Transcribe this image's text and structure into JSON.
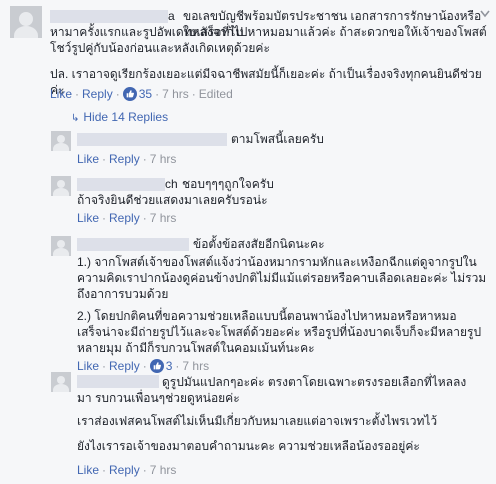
{
  "comment": {
    "name_suffix": "a",
    "text_line1": "ขอเลขบัญชีพร้อมบัตรประชาชน เอกสารการรักษาน้องหรือใบเสร็จที่ไป",
    "text_line2": "หามาครั้งแรกและรูปอัพเดทหลังจากไปหาหมอมาแล้วค่ะ ถ้าสะดวกขอให้เจ้าของโพสต์",
    "text_line3": "โชว์รูปคู่กับน้องก่อนและหลังเกิดเหตุด้วยค่ะ",
    "text_line4": "ปล. เราอาจดูเรียกร้องเยอะแต่มีจฉาชีพสมัยนี้ก็เยอะค่ะ ถ้าเป็นเรื่องจริงทุกคนยินดีช่วยค่ะ",
    "like": "Like",
    "reply": "Reply",
    "likes_count": "35",
    "time": "7 hrs",
    "edited": "Edited"
  },
  "hide_replies": "Hide 14 Replies",
  "replies": [
    {
      "name_suffix": "",
      "text": "ตามโพสนี้เลยครับ",
      "like": "Like",
      "reply": "Reply",
      "time": "7 hrs"
    },
    {
      "name_suffix": "ch",
      "text_line1": "ชอบๆๆๆถูกใจครับ",
      "text_line2": "ถ้าจริงยินดีช่วยแสดงมาเลยครับรอน่ะ",
      "like": "Like",
      "reply": "Reply",
      "time": "7 hrs"
    },
    {
      "name_suffix": "",
      "header_text": "ข้อตั้งข้อสงสัยอีกนิดนะคะ",
      "p1_line1": "1.) จากโพสต์เจ้าของโพสต์แจ้งว่าน้องหมากรามหักและเหงือกฉีกแต่ดูจากรูปใน",
      "p1_line2": "ความคิดเราปากน้องดูค่อนข้างปกติไม่มีแม้แต่รอยหรือคาบเลือดเลยอะค่ะ ไม่รวม",
      "p1_line3": "ถึงอาการบวมด้วย",
      "p2_line1": "2.) โดยปกติคนที่ขอความช่วยเหลือแบบนี้ตอนพาน้องไปหาหมอหรือหาหมอ",
      "p2_line2": "เสร็จน่าจะมีถ่ายรูปไว้และจะโพสต์ด้วยอะค่ะ หรือรูปที่น้องบาดเจ็บก็จะมีหลายรูป",
      "p2_line3": "หลายมุม ถ้ามีก็รบกวนโพสต์ในคอมเม้นท์นะคะ",
      "like": "Like",
      "reply": "Reply",
      "likes_count": "3",
      "time": "7 hrs"
    },
    {
      "name_suffix": "",
      "line1": "ดูรูปมันแปลกๆอะค่ะ ตรงตาโดยเฉพาะตรงรอยเลือกที่ไหลลง",
      "line2": "มา รบกวนเพื่อนๆช่วยดูหน่อยค่ะ",
      "line3": "เราส่องเฟสคนโพสต์ไม่เห็นมีเกี่ยวกับหมาเลยแต่อาจเพราะตั้งไพรเวทไว้",
      "line4": "ยังไงเรารอเจ้าของมาตอบคำถามนะคะ ความช่วยเหลือน้องรออยู่ค่ะ",
      "like": "Like",
      "reply": "Reply",
      "time": "7 hrs"
    }
  ],
  "colors": {
    "background": "#f6f7f9",
    "link": "#4267b2",
    "meta": "#90949c",
    "text": "#1d2129"
  },
  "icons": {
    "like_badge": "thumbs-up-icon",
    "hide_arrow": "reply-arrow-icon",
    "menu": "chevron-down-icon"
  }
}
